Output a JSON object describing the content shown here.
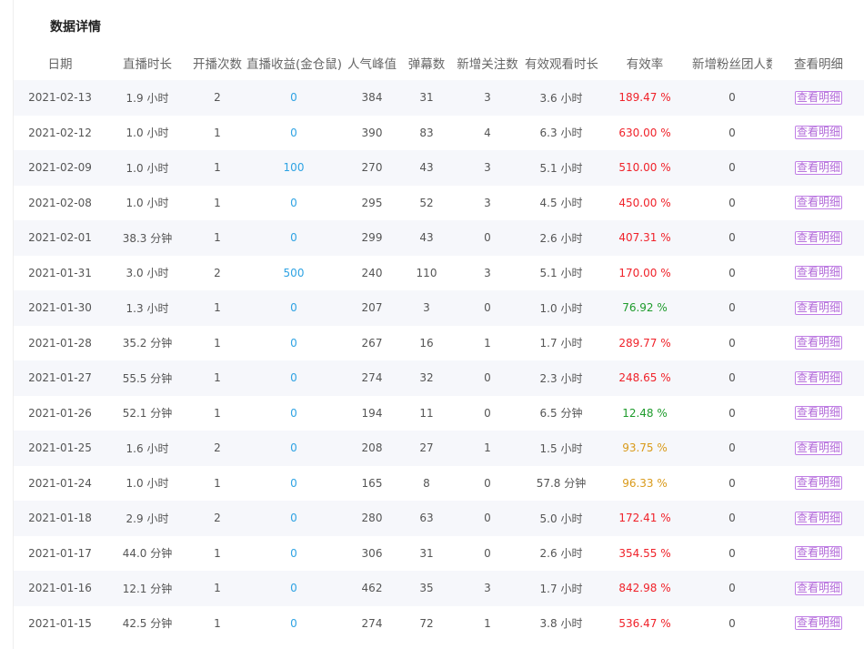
{
  "page": {
    "title": "数据详情"
  },
  "table": {
    "headers": [
      "日期",
      "直播时长",
      "开播次数",
      "直播收益(金仓鼠)",
      "人气峰值",
      "弹幕数",
      "新增关注数",
      "有效观看时长",
      "有效率",
      "新增粉丝团人数",
      "查看明细"
    ],
    "detail_label": "查看明细",
    "rows": [
      {
        "date": "2021-02-13",
        "duration": "1.9 小时",
        "sessions": "2",
        "income": "0",
        "peak": "384",
        "danmaku": "31",
        "follows": "3",
        "watch": "3.6 小时",
        "rate": "189.47 %",
        "rate_level": "red",
        "fans": "0"
      },
      {
        "date": "2021-02-12",
        "duration": "1.0 小时",
        "sessions": "1",
        "income": "0",
        "peak": "390",
        "danmaku": "83",
        "follows": "4",
        "watch": "6.3 小时",
        "rate": "630.00 %",
        "rate_level": "red",
        "fans": "0"
      },
      {
        "date": "2021-02-09",
        "duration": "1.0 小时",
        "sessions": "1",
        "income": "100",
        "peak": "270",
        "danmaku": "43",
        "follows": "3",
        "watch": "5.1 小时",
        "rate": "510.00 %",
        "rate_level": "red",
        "fans": "0"
      },
      {
        "date": "2021-02-08",
        "duration": "1.0 小时",
        "sessions": "1",
        "income": "0",
        "peak": "295",
        "danmaku": "52",
        "follows": "3",
        "watch": "4.5 小时",
        "rate": "450.00 %",
        "rate_level": "red",
        "fans": "0"
      },
      {
        "date": "2021-02-01",
        "duration": "38.3 分钟",
        "sessions": "1",
        "income": "0",
        "peak": "299",
        "danmaku": "43",
        "follows": "0",
        "watch": "2.6 小时",
        "rate": "407.31 %",
        "rate_level": "red",
        "fans": "0"
      },
      {
        "date": "2021-01-31",
        "duration": "3.0 小时",
        "sessions": "2",
        "income": "500",
        "peak": "240",
        "danmaku": "110",
        "follows": "3",
        "watch": "5.1 小时",
        "rate": "170.00 %",
        "rate_level": "red",
        "fans": "0"
      },
      {
        "date": "2021-01-30",
        "duration": "1.3 小时",
        "sessions": "1",
        "income": "0",
        "peak": "207",
        "danmaku": "3",
        "follows": "0",
        "watch": "1.0 小时",
        "rate": "76.92 %",
        "rate_level": "green",
        "fans": "0"
      },
      {
        "date": "2021-01-28",
        "duration": "35.2 分钟",
        "sessions": "1",
        "income": "0",
        "peak": "267",
        "danmaku": "16",
        "follows": "1",
        "watch": "1.7 小时",
        "rate": "289.77 %",
        "rate_level": "red",
        "fans": "0"
      },
      {
        "date": "2021-01-27",
        "duration": "55.5 分钟",
        "sessions": "1",
        "income": "0",
        "peak": "274",
        "danmaku": "32",
        "follows": "0",
        "watch": "2.3 小时",
        "rate": "248.65 %",
        "rate_level": "red",
        "fans": "0"
      },
      {
        "date": "2021-01-26",
        "duration": "52.1 分钟",
        "sessions": "1",
        "income": "0",
        "peak": "194",
        "danmaku": "11",
        "follows": "0",
        "watch": "6.5 分钟",
        "rate": "12.48 %",
        "rate_level": "green",
        "fans": "0"
      },
      {
        "date": "2021-01-25",
        "duration": "1.6 小时",
        "sessions": "2",
        "income": "0",
        "peak": "208",
        "danmaku": "27",
        "follows": "1",
        "watch": "1.5 小时",
        "rate": "93.75 %",
        "rate_level": "orange",
        "fans": "0"
      },
      {
        "date": "2021-01-24",
        "duration": "1.0 小时",
        "sessions": "1",
        "income": "0",
        "peak": "165",
        "danmaku": "8",
        "follows": "0",
        "watch": "57.8 分钟",
        "rate": "96.33 %",
        "rate_level": "orange",
        "fans": "0"
      },
      {
        "date": "2021-01-18",
        "duration": "2.9 小时",
        "sessions": "2",
        "income": "0",
        "peak": "280",
        "danmaku": "63",
        "follows": "0",
        "watch": "5.0 小时",
        "rate": "172.41 %",
        "rate_level": "red",
        "fans": "0"
      },
      {
        "date": "2021-01-17",
        "duration": "44.0 分钟",
        "sessions": "1",
        "income": "0",
        "peak": "306",
        "danmaku": "31",
        "follows": "0",
        "watch": "2.6 小时",
        "rate": "354.55 %",
        "rate_level": "red",
        "fans": "0"
      },
      {
        "date": "2021-01-16",
        "duration": "12.1 分钟",
        "sessions": "1",
        "income": "0",
        "peak": "462",
        "danmaku": "35",
        "follows": "3",
        "watch": "1.7 小时",
        "rate": "842.98 %",
        "rate_level": "red",
        "fans": "0"
      },
      {
        "date": "2021-01-15",
        "duration": "42.5 分钟",
        "sessions": "1",
        "income": "0",
        "peak": "274",
        "danmaku": "72",
        "follows": "1",
        "watch": "3.8 小时",
        "rate": "536.47 %",
        "rate_level": "red",
        "fans": "0"
      }
    ]
  },
  "colors": {
    "income": "#2ea3e3",
    "rate_red": "#f0222a",
    "rate_green": "#1e9b2c",
    "rate_orange": "#d99a1a",
    "detail_button": "#b26ad9",
    "row_stripe": "#f6f7fb"
  }
}
